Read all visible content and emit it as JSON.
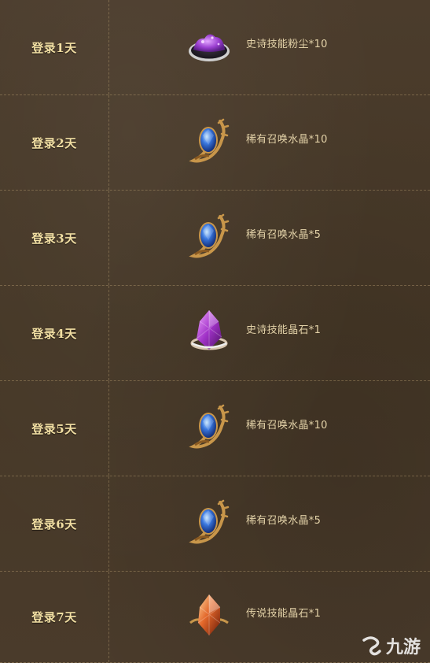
{
  "rows": [
    {
      "day": "登录1天",
      "reward": "史诗技能粉尘*10",
      "icon": "purple-dust-icon"
    },
    {
      "day": "登录2天",
      "reward": "稀有召唤水晶*10",
      "icon": "blue-crystal-icon"
    },
    {
      "day": "登录3天",
      "reward": "稀有召唤水晶*5",
      "icon": "blue-crystal-icon"
    },
    {
      "day": "登录4天",
      "reward": "史诗技能晶石*1",
      "icon": "purple-shard-icon"
    },
    {
      "day": "登录5天",
      "reward": "稀有召唤水晶*10",
      "icon": "blue-crystal-icon"
    },
    {
      "day": "登录6天",
      "reward": "稀有召唤水晶*5",
      "icon": "blue-crystal-icon"
    },
    {
      "day": "登录7天",
      "reward": "传说技能晶石*1",
      "icon": "orange-shard-icon"
    }
  ],
  "watermark": {
    "text": "九游",
    "icon": "jiuyou-logo-icon"
  },
  "colors": {
    "background": "#4a3b2b",
    "day_text": "#f2dfa3",
    "reward_text": "#e3d2a8",
    "divider": "#d2b482"
  }
}
